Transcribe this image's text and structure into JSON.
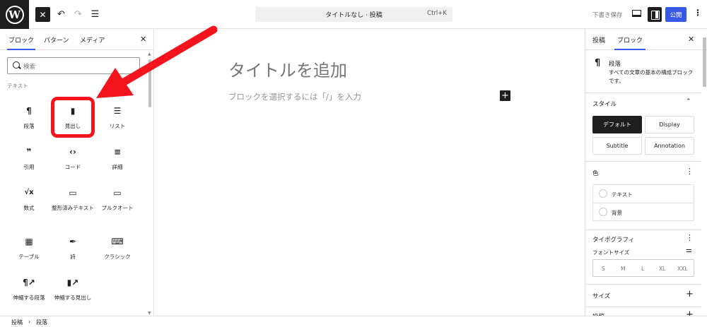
{
  "topbar": {
    "logo": "W",
    "doc_title": "タイトルなし · 投稿",
    "shortcut": "Ctrl+K",
    "draft_label": "下書き保存",
    "publish_label": "公開"
  },
  "inserter": {
    "tabs": [
      "ブロック",
      "パターン",
      "メディア"
    ],
    "search_placeholder": "検索",
    "category": "テキスト",
    "blocks": [
      {
        "label": "段落",
        "icon": "¶"
      },
      {
        "label": "見出し",
        "icon": "🔖"
      },
      {
        "label": "リスト",
        "icon": "☰"
      },
      {
        "label": "引用",
        "icon": "❞"
      },
      {
        "label": "コード",
        "icon": "‹›"
      },
      {
        "label": "詳細",
        "icon": "≡"
      },
      {
        "label": "数式",
        "icon": "√x"
      },
      {
        "label": "整形済みテキスト",
        "icon": "▭"
      },
      {
        "label": "プルクオート",
        "icon": "▭"
      },
      {
        "label": "テーブル",
        "icon": "▦"
      },
      {
        "label": "詩",
        "icon": "✒"
      },
      {
        "label": "クラシック",
        "icon": "⌨"
      },
      {
        "label": "伸縮する段落",
        "icon": "¶↗"
      },
      {
        "label": "伸縮する見出し",
        "icon": "🔖↗"
      }
    ]
  },
  "editor": {
    "title_placeholder": "タイトルを追加",
    "body_placeholder": "ブロックを選択するには「/」を入力",
    "add_block": "+"
  },
  "settings": {
    "tabs": [
      "投稿",
      "ブロック"
    ],
    "block_name": "段落",
    "block_desc": "すべての文章の基本の構成ブロックです。",
    "style_title": "スタイル",
    "styles": [
      "デフォルト",
      "Display",
      "Subtitle",
      "Annotation"
    ],
    "color_title": "色",
    "colors": [
      "テキスト",
      "背景"
    ],
    "typography_title": "タイポグラフィ",
    "font_size_label": "フォントサイズ",
    "sizes": [
      "S",
      "M",
      "L",
      "XL",
      "XXL"
    ],
    "size_title": "サイズ",
    "next_section": "投稿"
  },
  "footer": {
    "crumbs": [
      "投稿",
      "段落"
    ]
  },
  "colors": {
    "accent": "#3858e9",
    "highlight": "#f4141d"
  }
}
